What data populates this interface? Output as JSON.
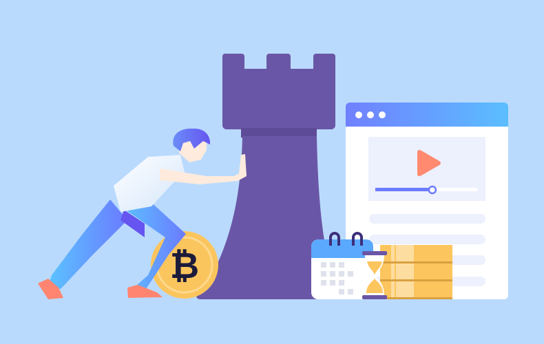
{
  "illustration": {
    "coin_symbol": "₿",
    "video_progress": 0.56,
    "browser_dots": 3,
    "content_lines": 4
  },
  "colors": {
    "background": "#B9DAFD",
    "rook": "#6A56A6",
    "rook_shade": "#5E4B98",
    "browser_header_start": "#7080FF",
    "browser_header_end": "#5BBEFF",
    "panel": "#EDF0FD",
    "play": "#FF8A70",
    "slider": "#6B7BFF",
    "coin": "#FBC55E",
    "coin_ring": "#FDD98E",
    "coin_symbol": "#1C1B3A",
    "money": "#FDC55E",
    "shoe": "#FF8570",
    "skin": "#FFEBDD",
    "hair": "#6A6BF5"
  }
}
